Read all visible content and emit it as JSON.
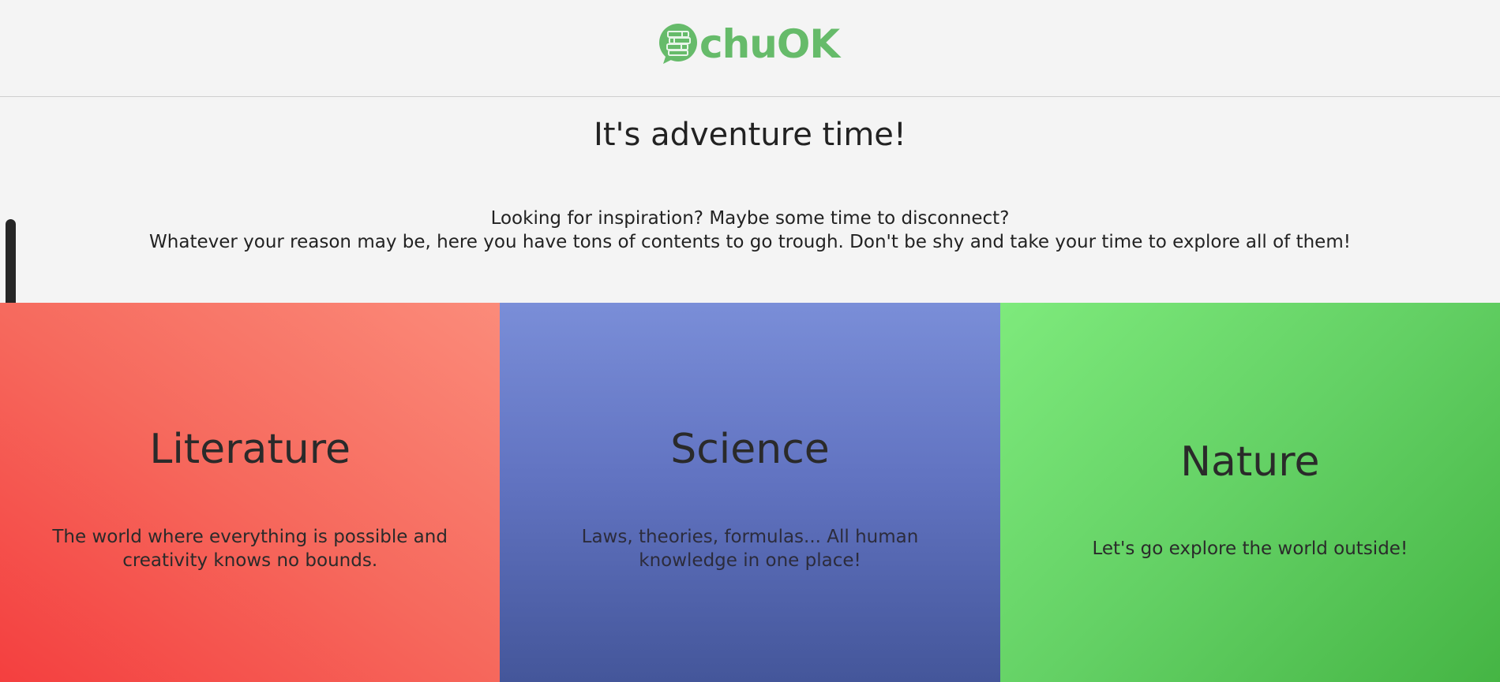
{
  "header": {
    "logo_text": "chuOK",
    "logo_color": "#66bb6a"
  },
  "intro": {
    "title": "It's adventure time!",
    "line1": "Looking for inspiration? Maybe some time to disconnect?",
    "line2": "Whatever your reason may be, here you have tons of contents to go trough. Don't be shy and take your time to explore all of them!"
  },
  "categories": [
    {
      "title": "Literature",
      "description": "The world where everything is possible and creativity knows no bounds.",
      "color": "#f6695d"
    },
    {
      "title": "Science",
      "description": "Laws, theories, formulas... All human knowledge in one place!",
      "color": "#6274c2"
    },
    {
      "title": "Nature",
      "description": "Let's go explore the world outside!",
      "color": "#63d064"
    }
  ]
}
